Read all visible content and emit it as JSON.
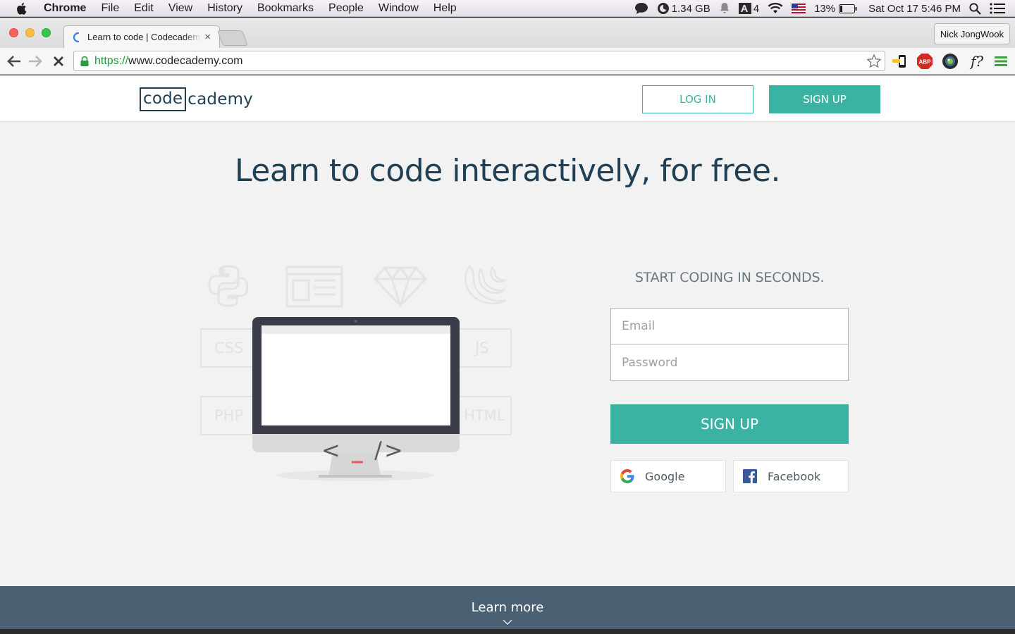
{
  "menubar": {
    "app_name": "Chrome",
    "items": [
      "File",
      "Edit",
      "View",
      "History",
      "Bookmarks",
      "People",
      "Window",
      "Help"
    ],
    "memory": "1.34 GB",
    "adobe_count": "4",
    "battery": "13%",
    "clock": "Sat Oct 17  5:46 PM"
  },
  "browser": {
    "tab_title": "Learn to code | Codecademy",
    "tab_close": "×",
    "profile_name": "Nick JongWook",
    "url_scheme": "https://",
    "url_rest": "www.codecademy.com",
    "ext_formula": "f?"
  },
  "site": {
    "logo_code": "code",
    "logo_rest": "cademy",
    "login_label": "LOG IN",
    "signup_top_label": "SIGN UP",
    "headline": "Learn to code interactively, for free.",
    "ghost_labels": {
      "css": "CSS",
      "js": "JS",
      "php": "PHP",
      "html": "HTML"
    },
    "screen_code": {
      "lt": "<",
      "cursor": "_",
      "slash_gt": "/>"
    },
    "form_heading": "START CODING IN SECONDS.",
    "email_placeholder": "Email",
    "password_placeholder": "Password",
    "signup_main_label": "SIGN UP",
    "google_label": "Google",
    "facebook_label": "Facebook",
    "learn_more_label": "Learn more"
  },
  "colors": {
    "brand_teal": "#3bb3a3",
    "brand_navy": "#204056",
    "footer_slate": "#4b6173",
    "cursor_red": "#f0535a"
  }
}
